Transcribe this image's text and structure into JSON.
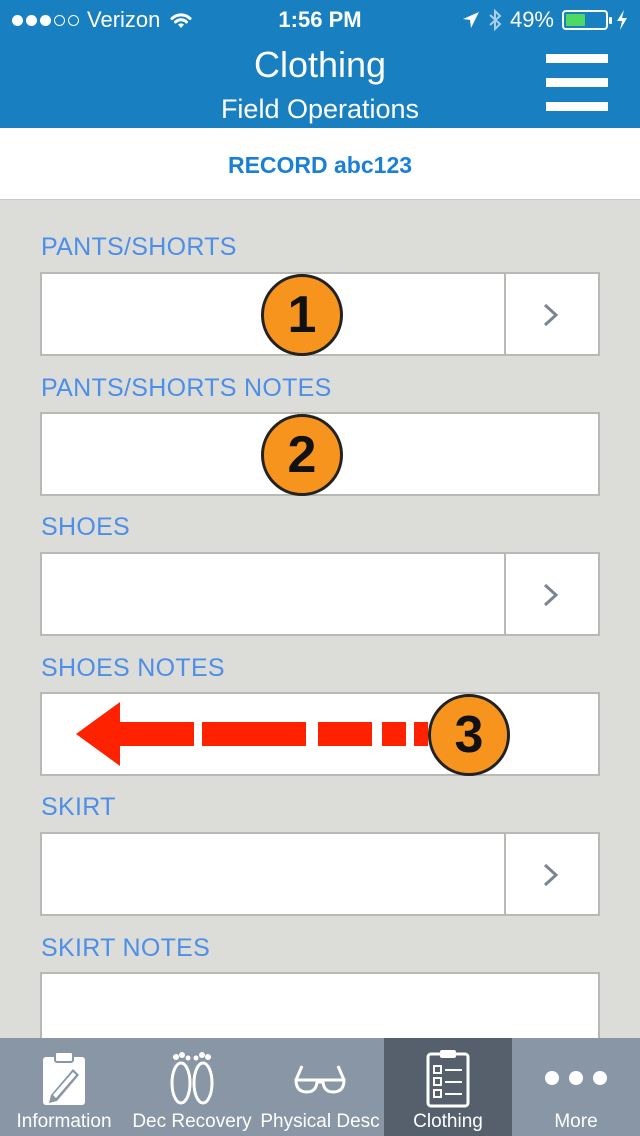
{
  "status_bar": {
    "carrier": "Verizon",
    "time": "1:56 PM",
    "battery_percent": "49%",
    "battery_level": 0.49,
    "signal_bars": 3,
    "signal_total": 5
  },
  "header": {
    "title": "Clothing",
    "subtitle": "Field Operations",
    "menu_icon": "hamburger-menu-icon"
  },
  "record": {
    "label": "RECORD abc123"
  },
  "form": {
    "fields": [
      {
        "label": "PANTS/SHORTS",
        "type": "select",
        "value": ""
      },
      {
        "label": "PANTS/SHORTS NOTES",
        "type": "text",
        "value": ""
      },
      {
        "label": "SHOES",
        "type": "select",
        "value": ""
      },
      {
        "label": "SHOES NOTES",
        "type": "text",
        "value": ""
      },
      {
        "label": "SKIRT",
        "type": "select",
        "value": ""
      },
      {
        "label": "SKIRT NOTES",
        "type": "text",
        "value": ""
      }
    ]
  },
  "annotations": {
    "badges": [
      "1",
      "2",
      "3"
    ],
    "badge_color": "#f7941d",
    "arrow_color": "#ff2200"
  },
  "tabs": [
    {
      "label": "Information",
      "icon": "pencil-clipboard-icon",
      "active": false
    },
    {
      "label": "Dec Recovery",
      "icon": "footprints-icon",
      "active": false
    },
    {
      "label": "Physical Desc",
      "icon": "glasses-icon",
      "active": false
    },
    {
      "label": "Clothing",
      "icon": "checklist-icon",
      "active": true
    },
    {
      "label": "More",
      "icon": "more-dots-icon",
      "active": false
    }
  ],
  "colors": {
    "header_blue": "#1880c0",
    "label_blue": "#4d8fe8",
    "record_blue": "#1a7fd6",
    "background": "#dcdcd8",
    "tab_bar": "#8896a6",
    "tab_active": "#55606c"
  }
}
